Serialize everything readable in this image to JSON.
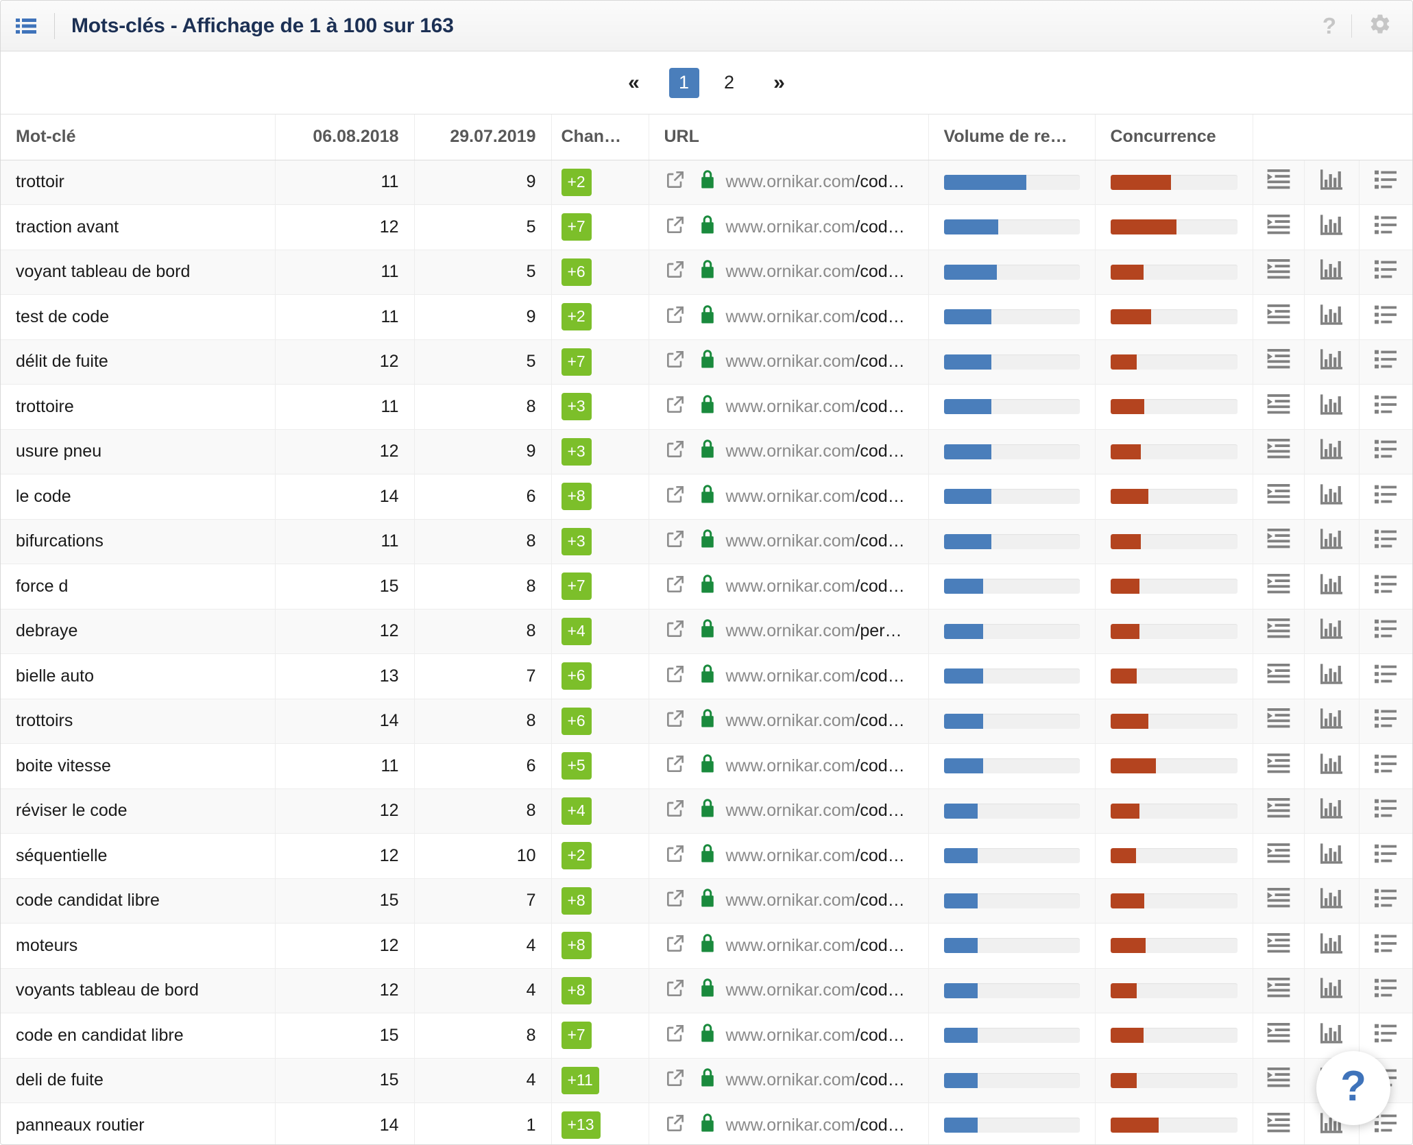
{
  "header": {
    "title": "Mots-clés - Affichage de 1 à 100 sur 163",
    "menu_icon": "list-grid-icon",
    "help_label": "?",
    "settings_icon": "gear-icon"
  },
  "pagination": {
    "first_label": "«",
    "last_label": "»",
    "pages": [
      "1",
      "2"
    ],
    "active_page": "1"
  },
  "table": {
    "columns": [
      {
        "label": "Mot-clé",
        "align": "left"
      },
      {
        "label": "06.08.2018",
        "align": "right"
      },
      {
        "label": "29.07.2019",
        "align": "right"
      },
      {
        "label": "Chan…",
        "align": "left"
      },
      {
        "label": "URL",
        "align": "left"
      },
      {
        "label": "Volume de re…",
        "align": "left"
      },
      {
        "label": "Concurrence",
        "align": "left"
      },
      {
        "label": "",
        "align": "left"
      }
    ],
    "url_host": "www.ornikar.com",
    "rows": [
      {
        "keyword": "trottoir",
        "d1": "11",
        "d2": "9",
        "change": "+2",
        "path": "/cod…",
        "volume": 61,
        "competition": 48
      },
      {
        "keyword": "traction avant",
        "d1": "12",
        "d2": "5",
        "change": "+7",
        "path": "/cod…",
        "volume": 40,
        "competition": 52
      },
      {
        "keyword": "voyant tableau de bord",
        "d1": "11",
        "d2": "5",
        "change": "+6",
        "path": "/cod…",
        "volume": 39,
        "competition": 26
      },
      {
        "keyword": "test de code",
        "d1": "11",
        "d2": "9",
        "change": "+2",
        "path": "/cod…",
        "volume": 35,
        "competition": 32
      },
      {
        "keyword": "délit de fuite",
        "d1": "12",
        "d2": "5",
        "change": "+7",
        "path": "/cod…",
        "volume": 35,
        "competition": 21
      },
      {
        "keyword": "trottoire",
        "d1": "11",
        "d2": "8",
        "change": "+3",
        "path": "/cod…",
        "volume": 35,
        "competition": 27
      },
      {
        "keyword": "usure pneu",
        "d1": "12",
        "d2": "9",
        "change": "+3",
        "path": "/cod…",
        "volume": 35,
        "competition": 24
      },
      {
        "keyword": "le code",
        "d1": "14",
        "d2": "6",
        "change": "+8",
        "path": "/cod…",
        "volume": 35,
        "competition": 30
      },
      {
        "keyword": "bifurcations",
        "d1": "11",
        "d2": "8",
        "change": "+3",
        "path": "/cod…",
        "volume": 35,
        "competition": 24
      },
      {
        "keyword": "force d",
        "d1": "15",
        "d2": "8",
        "change": "+7",
        "path": "/cod…",
        "volume": 29,
        "competition": 23
      },
      {
        "keyword": "debraye",
        "d1": "12",
        "d2": "8",
        "change": "+4",
        "path": "/per…",
        "volume": 29,
        "competition": 23
      },
      {
        "keyword": "bielle auto",
        "d1": "13",
        "d2": "7",
        "change": "+6",
        "path": "/cod…",
        "volume": 29,
        "competition": 21
      },
      {
        "keyword": "trottoirs",
        "d1": "14",
        "d2": "8",
        "change": "+6",
        "path": "/cod…",
        "volume": 29,
        "competition": 30
      },
      {
        "keyword": "boite vitesse",
        "d1": "11",
        "d2": "6",
        "change": "+5",
        "path": "/cod…",
        "volume": 29,
        "competition": 36
      },
      {
        "keyword": "réviser le code",
        "d1": "12",
        "d2": "8",
        "change": "+4",
        "path": "/cod…",
        "volume": 25,
        "competition": 23
      },
      {
        "keyword": "séquentielle",
        "d1": "12",
        "d2": "10",
        "change": "+2",
        "path": "/cod…",
        "volume": 25,
        "competition": 20
      },
      {
        "keyword": "code candidat libre",
        "d1": "15",
        "d2": "7",
        "change": "+8",
        "path": "/cod…",
        "volume": 25,
        "competition": 27
      },
      {
        "keyword": "moteurs",
        "d1": "12",
        "d2": "4",
        "change": "+8",
        "path": "/cod…",
        "volume": 25,
        "competition": 28
      },
      {
        "keyword": "voyants tableau de bord",
        "d1": "12",
        "d2": "4",
        "change": "+8",
        "path": "/cod…",
        "volume": 25,
        "competition": 21
      },
      {
        "keyword": "code en candidat libre",
        "d1": "15",
        "d2": "8",
        "change": "+7",
        "path": "/cod…",
        "volume": 25,
        "competition": 26
      },
      {
        "keyword": "deli de fuite",
        "d1": "15",
        "d2": "4",
        "change": "+11",
        "path": "/cod…",
        "volume": 25,
        "competition": 21
      },
      {
        "keyword": "panneaux routier",
        "d1": "14",
        "d2": "1",
        "change": "+13",
        "path": "/cod…",
        "volume": 25,
        "competition": 38
      }
    ],
    "action_icons": [
      "indent-list-icon",
      "bar-chart-icon",
      "list-icon"
    ]
  },
  "floating_help": {
    "label": "?"
  },
  "colors": {
    "accent_blue": "#4a7ebb",
    "badge_green": "#7cbf2a",
    "bar_red": "#b4441f",
    "title_navy": "#1c3054",
    "lock_green": "#1a8a3d"
  }
}
